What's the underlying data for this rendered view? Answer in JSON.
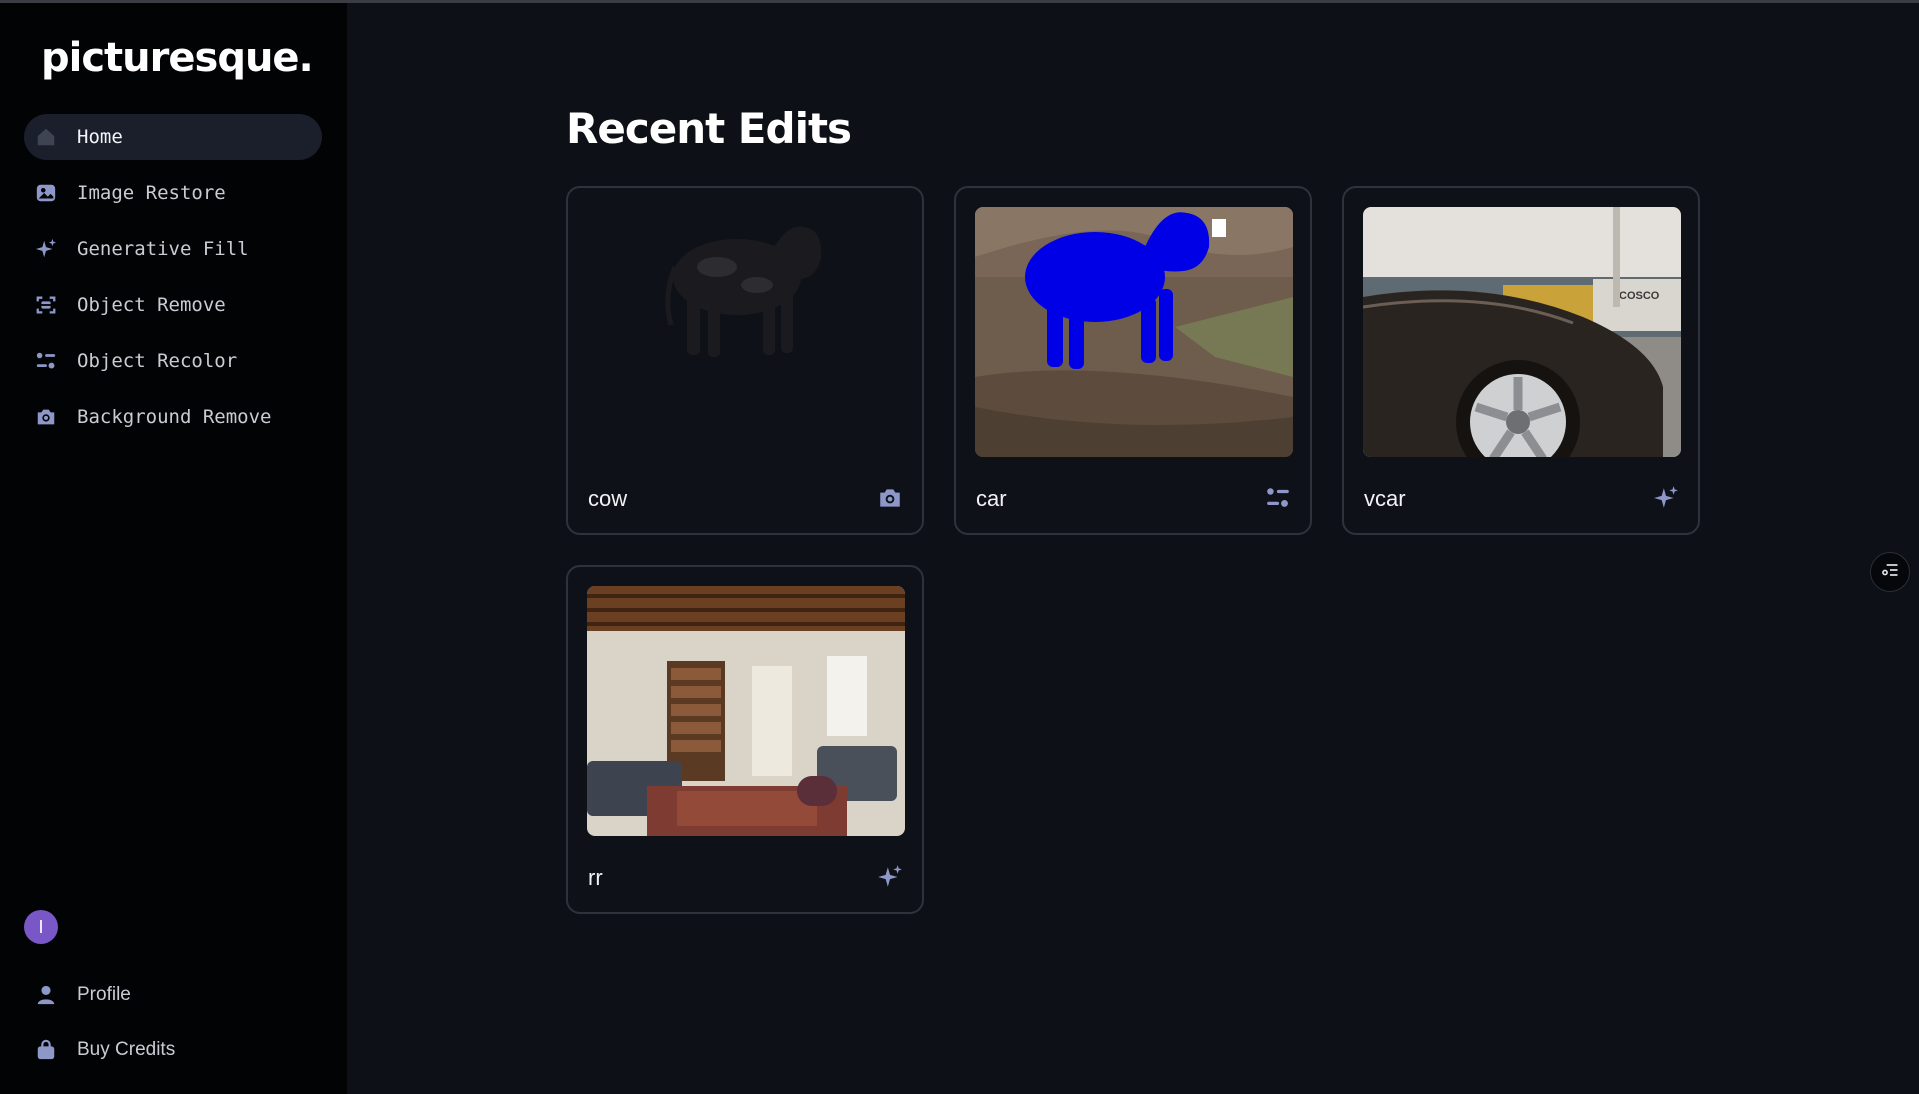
{
  "app": {
    "logo": "picturesque."
  },
  "sidebar": {
    "items": [
      {
        "label": "Home",
        "icon": "home-icon",
        "active": true
      },
      {
        "label": "Image Restore",
        "icon": "image-icon"
      },
      {
        "label": "Generative Fill",
        "icon": "sparkles-icon"
      },
      {
        "label": "Object Remove",
        "icon": "scan-remove-icon"
      },
      {
        "label": "Object Recolor",
        "icon": "adjust-icon"
      },
      {
        "label": "Background Remove",
        "icon": "camera-icon"
      }
    ],
    "avatar_initial": "I",
    "bottom_items": [
      {
        "label": "Profile",
        "icon": "user-icon"
      },
      {
        "label": "Buy Credits",
        "icon": "bag-icon"
      }
    ]
  },
  "main": {
    "title": "Recent Edits",
    "cards": [
      {
        "title": "cow",
        "icon": "camera-icon",
        "image": "cow-cutout"
      },
      {
        "title": "car",
        "icon": "adjust-icon",
        "image": "cow-blue-mask"
      },
      {
        "title": "vcar",
        "icon": "sparkles-icon",
        "image": "car-wheel"
      },
      {
        "title": "rr",
        "icon": "sparkles-icon",
        "image": "living-room"
      }
    ]
  },
  "colors": {
    "accent_icon": "#8d98c8",
    "avatar": "#7a57c7",
    "active_nav": "#1a1f2b"
  }
}
